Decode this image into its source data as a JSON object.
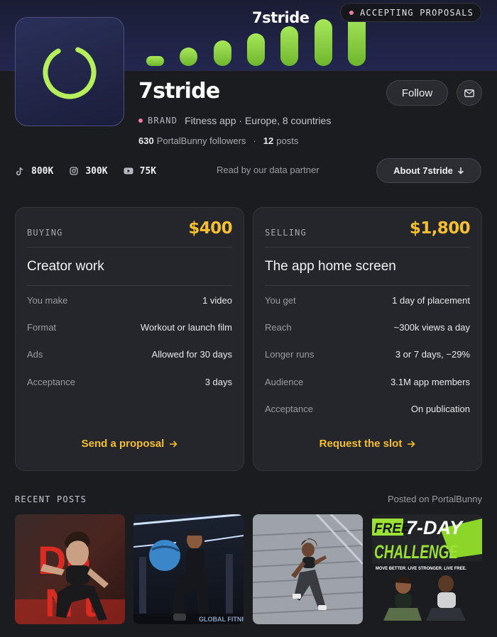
{
  "banner": {
    "wordmark": "7stride",
    "status": "ACCEPTING PROPOSALS"
  },
  "brand": {
    "name": "7stride",
    "tag": "BRAND",
    "description": "Fitness app · Europe, 8 countries",
    "followers_count": "630",
    "followers_label": "PortalBunny followers",
    "posts_count": "12",
    "posts_label": "posts"
  },
  "actions": {
    "follow_label": "Follow",
    "mail_icon": "mail-icon"
  },
  "socials": [
    {
      "icon": "tiktok-icon",
      "count": "800K"
    },
    {
      "icon": "instagram-icon",
      "count": "300K"
    },
    {
      "icon": "youtube-icon",
      "count": "75K"
    }
  ],
  "partner_note": "Read by our data partner",
  "about_label": "About 7stride",
  "buying": {
    "kind": "BUYING",
    "price": "$400",
    "title": "Creator work",
    "rows": [
      {
        "label": "You make",
        "value": "1 video"
      },
      {
        "label": "Format",
        "value": "Workout or launch film"
      },
      {
        "label": "Ads",
        "value": "Allowed for 30 days"
      },
      {
        "label": "Acceptance",
        "value": "3 days"
      }
    ],
    "cta": "Send a proposal"
  },
  "selling": {
    "kind": "SELLING",
    "price": "$1,800",
    "title": "The app home screen",
    "rows": [
      {
        "label": "You get",
        "value": "1 day of placement"
      },
      {
        "label": "Reach",
        "value": "~300k views a day"
      },
      {
        "label": "Longer runs",
        "value": "3 or 7 days, −29%"
      },
      {
        "label": "Audience",
        "value": "3.1M app members"
      },
      {
        "label": "Acceptance",
        "value": "On publication"
      }
    ],
    "cta": "Request the slot"
  },
  "recent_posts": {
    "title": "RECENT POSTS",
    "note": "Posted on PortalBunny",
    "thumb1_text": [
      "Do",
      "N't"
    ],
    "thumb3_text": [
      "FREE",
      "7-DAY",
      "CHALLENGE",
      "MOVE BETTER. LIVE STRONGER. LIVE FREE."
    ]
  },
  "colors": {
    "accent": "#f6bf2f",
    "ring": "#b5ef5c",
    "status_dot": "#f07a9a"
  }
}
